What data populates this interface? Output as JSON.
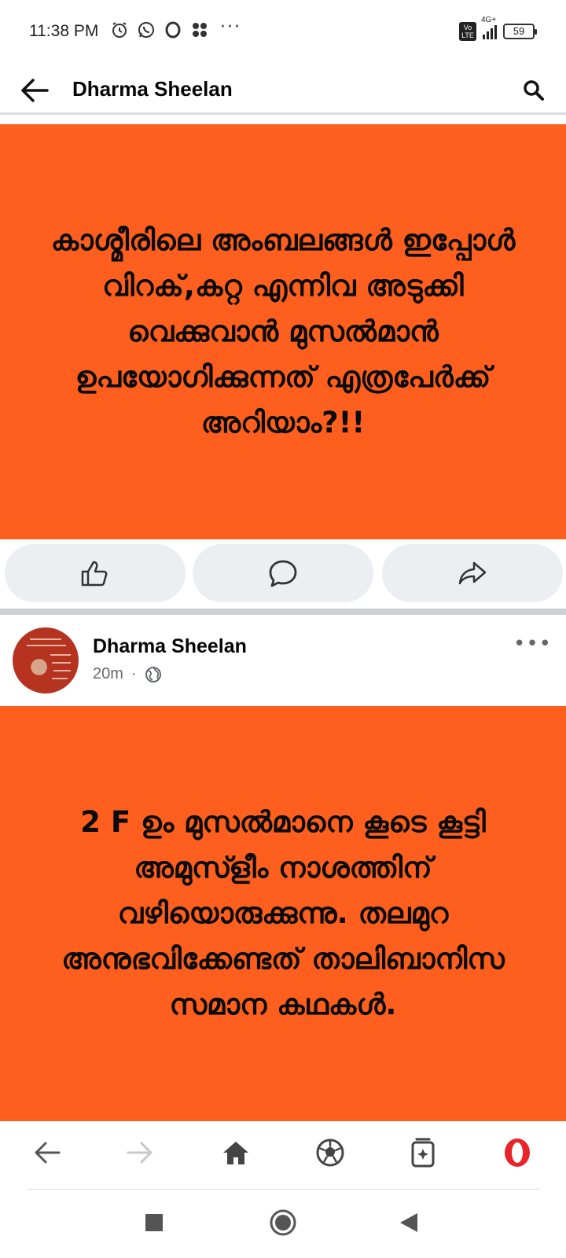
{
  "status_bar": {
    "time": "11:38 PM",
    "more": "···",
    "network": "4G+",
    "volte": "Vo LTE",
    "battery": "59"
  },
  "header": {
    "title": "Dharma Sheelan"
  },
  "post1": {
    "text": "കാശ്മീരിലെ അംബലങ്ങൾ ഇപ്പോൾ വിറക്,കറ്റ എന്നിവ അടുക്കി വെക്കുവാൻ മുസൽമാൻ ഉപയോഗിക്കുന്നത് എത്രപേർക്ക് അറിയാം?!!",
    "card_color": "#fe5f1e"
  },
  "post2": {
    "author": "Dharma Sheelan",
    "time": "20m",
    "separator": "·",
    "more": "•••",
    "text": "2 F ഉം മുസൽമാനെ കൂടെ കൂട്ടി അമുസ്ളീം നാശത്തിന് വഴിയൊരുക്കുന്നു. തലമുറ അനുഭവിക്കേണ്ടത് താലിബാനിസ സമാന കഥകൾ."
  },
  "colors": {
    "accent_orange": "#fe5f1e",
    "opera_red": "#e8232a",
    "button_bg": "#eceef2"
  }
}
